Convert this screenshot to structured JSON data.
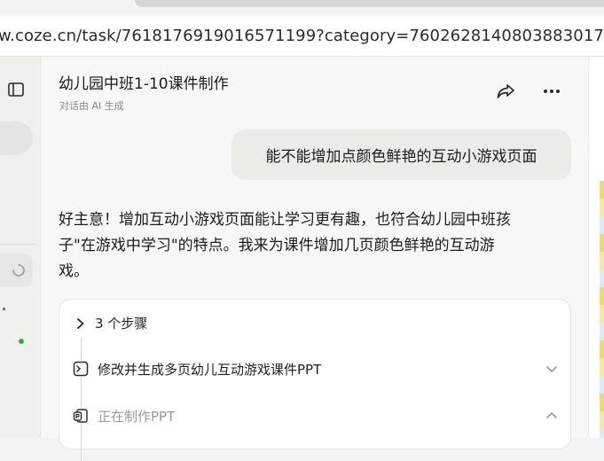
{
  "browser": {
    "address": "w.coze.cn/task/7618176919016571199?category=7602628140803883017"
  },
  "header": {
    "title": "幼儿园中班1-10课件制作",
    "subtitle": "对话由 AI 生成"
  },
  "messages": {
    "user": "能不能增加点颜色鲜艳的互动小游戏页面",
    "assistant_lines": [
      "好主意！增加互动小游戏页面能让学习更有趣，也符合幼儿园中班孩",
      "子\"在游戏中学习\"的特点。我来为课件增加几页颜色鲜艳的互动游",
      "戏。"
    ]
  },
  "steps": {
    "header": "3 个步骤",
    "items": [
      {
        "label": "修改并生成多页幼儿互动游戏课件PPT",
        "icon": "terminal-icon",
        "state": "collapsed"
      },
      {
        "label": "正在制作PPT",
        "icon": "ppt-icon",
        "state": "expanded"
      }
    ]
  },
  "colors": {
    "status_dot": "#22b14c",
    "bubble_bg": "#ebebe7"
  }
}
